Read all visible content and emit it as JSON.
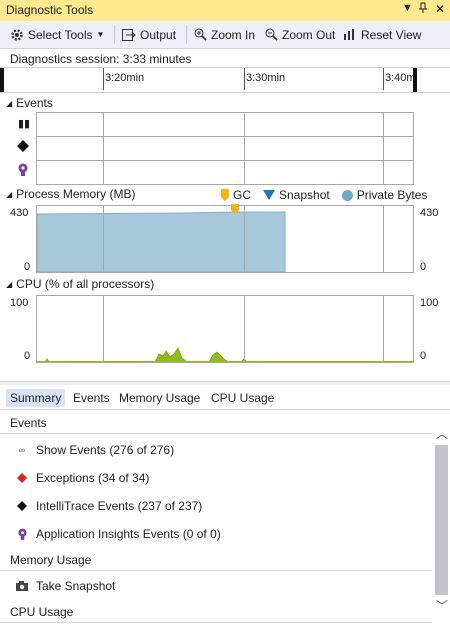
{
  "window": {
    "title": "Diagnostic Tools",
    "dropdown_icon": "chevron-down-icon",
    "pin_icon": "pin-icon",
    "close_icon": "close-icon"
  },
  "toolbar": {
    "select_tools": "Select Tools",
    "output": "Output",
    "zoom_in": "Zoom In",
    "zoom_out": "Zoom Out",
    "reset_view": "Reset View"
  },
  "session": {
    "label": "Diagnostics session: 3:33 minutes"
  },
  "timeline": {
    "ticks": [
      "3:20min",
      "3:30min",
      "3:40m"
    ]
  },
  "events_track": {
    "title": "Events"
  },
  "memory": {
    "title": "Process Memory (MB)",
    "legend": [
      "GC",
      "Snapshot",
      "Private Bytes"
    ],
    "max_label_left": "430",
    "min_label_left": "0",
    "max_label_right": "430",
    "min_label_right": "0",
    "fill_color": "#a6c8da"
  },
  "cpu": {
    "title": "CPU (% of all processors)",
    "max_label_left": "100",
    "min_label_left": "0",
    "max_label_right": "100",
    "min_label_right": "0",
    "fill_color": "#8fbc1c"
  },
  "tabs": [
    "Summary",
    "Events",
    "Memory Usage",
    "CPU Usage"
  ],
  "summary": {
    "events_header": "Events",
    "show_events": "Show Events (276 of 276)",
    "exceptions": "Exceptions (34 of 34)",
    "intellitrace": "IntelliTrace Events (237 of 237)",
    "app_insights": "Application Insights Events (0 of 0)",
    "memory_header": "Memory Usage",
    "take_snapshot": "Take Snapshot",
    "cpu_header": "CPU Usage"
  }
}
